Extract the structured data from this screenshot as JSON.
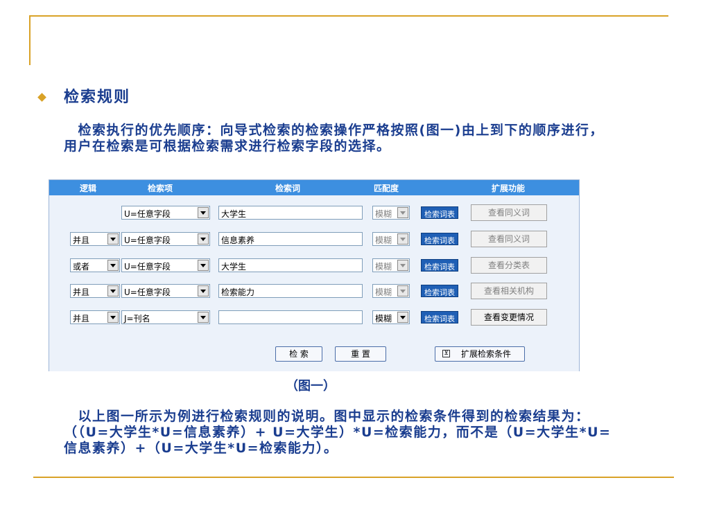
{
  "heading": "检索规则",
  "para1": "　检索执行的优先顺序：向导式检索的检索操作严格按照(图一)由上到下的顺序进行，用户在检索是可根据检索需求进行检索字段的选择。",
  "caption": "（图一）",
  "para2": "　以上图一所示为例进行检索规则的说明。图中显示的检索条件得到的检索结果为：（（U=大学生*U=信息素养）+ U=大学生）*U=检索能力，而不是（U=大学生*U=信息素养）+（U=大学生*U=检索能力）。",
  "form": {
    "headers": {
      "logic": "逻辑",
      "field": "检索项",
      "term": "检索词",
      "match": "匹配度",
      "extend": "扩展功能"
    },
    "rows": [
      {
        "logic": "",
        "field": "U=任意字段",
        "term": "大学生",
        "match": "模糊",
        "table_btn": "检索词表",
        "ext_btn": "查看同义词"
      },
      {
        "logic": "并且",
        "field": "U=任意字段",
        "term": "信息素养",
        "match": "模糊",
        "table_btn": "检索词表",
        "ext_btn": "查看同义词"
      },
      {
        "logic": "或者",
        "field": "U=任意字段",
        "term": "大学生",
        "match": "模糊",
        "table_btn": "检索词表",
        "ext_btn": "查看分类表"
      },
      {
        "logic": "并且",
        "field": "U=任意字段",
        "term": "检索能力",
        "match": "模糊",
        "table_btn": "检索词表",
        "ext_btn": "查看相关机构"
      },
      {
        "logic": "并且",
        "field": "J=刊名",
        "term": "",
        "match": "模糊",
        "table_btn": "检索词表",
        "ext_btn": "查看变更情况"
      }
    ],
    "search_btn": "检 索",
    "reset_btn": "重 置",
    "expand_btn": "扩展检索条件",
    "expand_icon": "⊻"
  }
}
